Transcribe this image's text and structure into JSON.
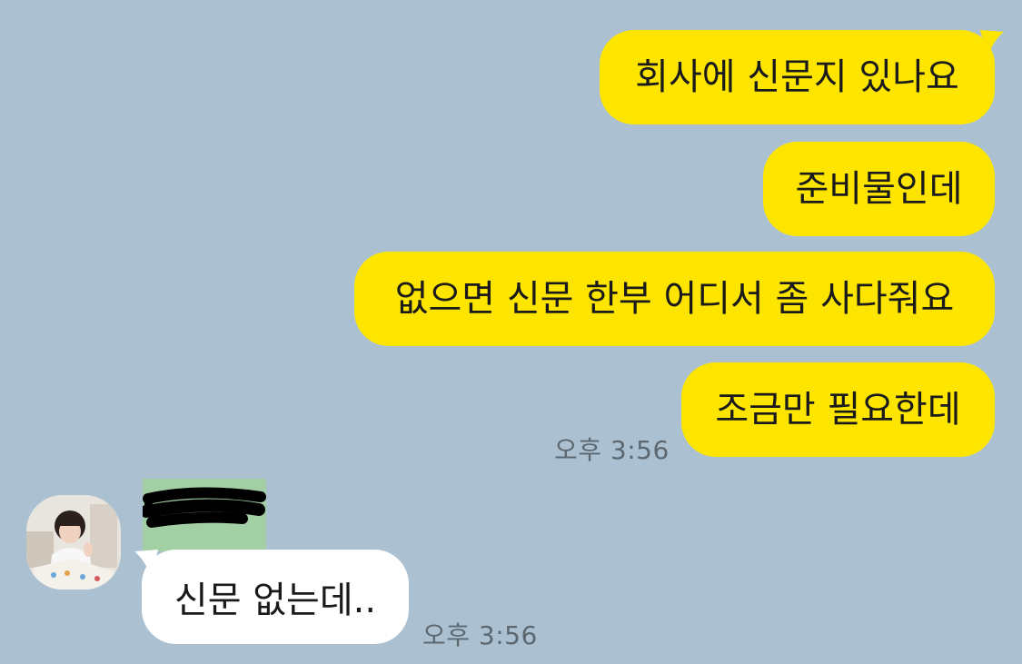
{
  "chat": {
    "outgoing": [
      {
        "text": "회사에 신문지 있나요"
      },
      {
        "text": "준비물인데"
      },
      {
        "text": "없으면 신문 한부 어디서 좀 사다줘요"
      },
      {
        "text": "조금만 필요한데"
      }
    ],
    "outgoing_time": "오후 3:56",
    "incoming": {
      "text": "신문 없는데..",
      "time": "오후 3:56"
    }
  },
  "colors": {
    "background": "#abc1d1",
    "outgoing_bubble": "#fee500",
    "incoming_bubble": "#ffffff",
    "timestamp": "#5c6770"
  },
  "icons": {
    "avatar": "profile-photo-child",
    "name_label": "redacted-sender-name"
  }
}
